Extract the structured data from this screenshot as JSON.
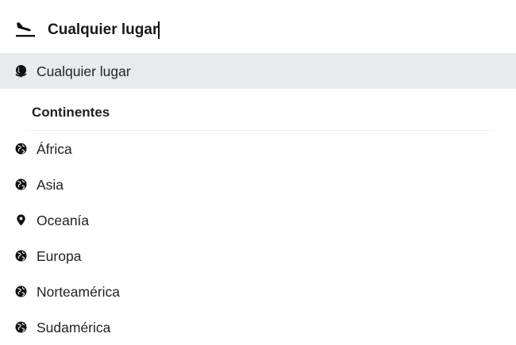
{
  "search": {
    "value": "Cualquier lugar",
    "icon": "plane-landing-icon"
  },
  "any_option": {
    "label": "Cualquier lugar",
    "icon": "globe-icon",
    "highlight_color": "#e8ebee"
  },
  "section": {
    "title": "Continentes"
  },
  "continents": [
    {
      "label": "África",
      "icon": "globe-icon"
    },
    {
      "label": "Asia",
      "icon": "globe-icon"
    },
    {
      "label": "Oceanía",
      "icon": "location-pin-icon"
    },
    {
      "label": "Europa",
      "icon": "globe-icon"
    },
    {
      "label": "Norteamérica",
      "icon": "globe-icon"
    },
    {
      "label": "Sudamérica",
      "icon": "globe-icon"
    }
  ]
}
